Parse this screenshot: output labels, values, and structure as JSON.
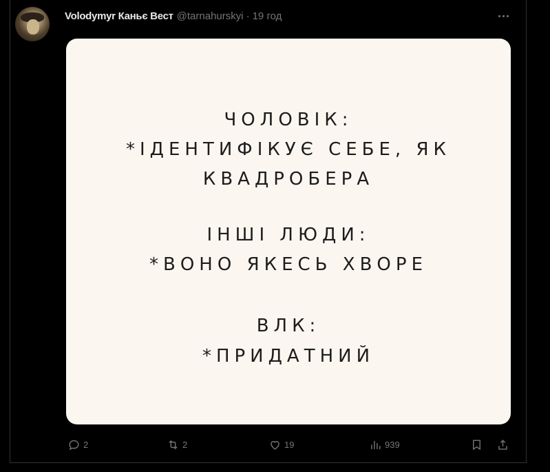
{
  "tweet": {
    "author_name": "Volodymyr Каньє Вест",
    "author_handle": "@tarnahurskyi",
    "separator": "·",
    "timestamp": "19 год",
    "more_icon": "more-horizontal-icon"
  },
  "media": {
    "background_color": "#fbf6f0",
    "lines": [
      "ЧОЛОВІК:",
      "*ІДЕНТИФІКУЄ СЕБЕ, ЯК",
      "КВАДРОБЕРА",
      "ІНШІ ЛЮДИ:",
      "*ВОНО ЯКЕСЬ ХВОРЕ",
      "ВЛК:",
      "*ПРИДАТНИЙ"
    ]
  },
  "actions": {
    "reply": {
      "icon": "reply-icon",
      "count": "2"
    },
    "retweet": {
      "icon": "retweet-icon",
      "count": "2"
    },
    "like": {
      "icon": "like-icon",
      "count": "19"
    },
    "views": {
      "icon": "views-icon",
      "count": "939"
    },
    "bookmark": {
      "icon": "bookmark-icon"
    },
    "share": {
      "icon": "share-icon"
    }
  },
  "colors": {
    "background": "#000000",
    "primary_text": "#e7e9ea",
    "secondary_text": "#71767b",
    "border": "#2f3336"
  }
}
